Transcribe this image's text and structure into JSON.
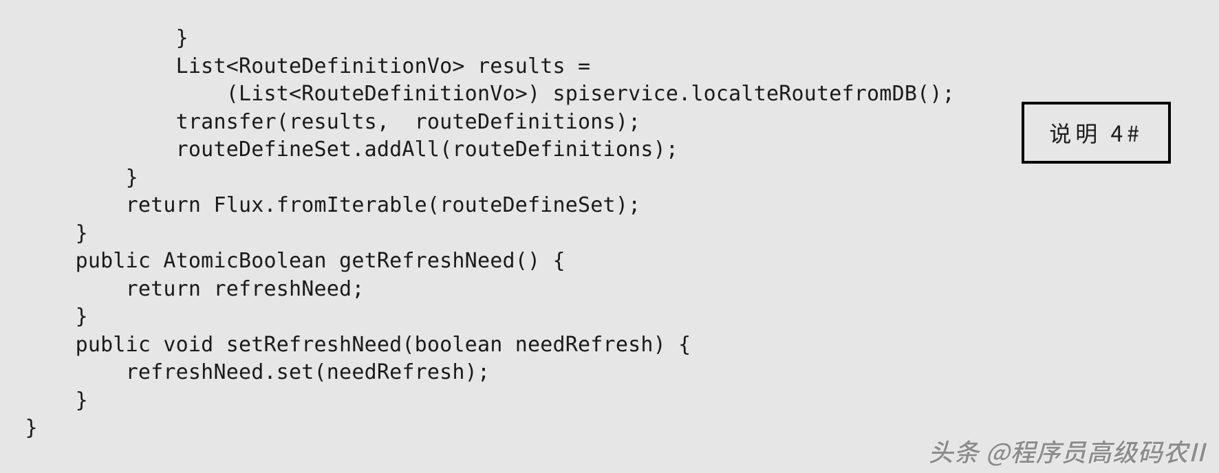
{
  "code": {
    "lines": [
      "              }",
      "              List<RouteDefinitionVo> results =",
      "                  (List<RouteDefinitionVo>) spiservice.localteRoutefromDB();",
      "              transfer(results,  routeDefinitions);",
      "              routeDefineSet.addAll(routeDefinitions);",
      "          }",
      "          return Flux.fromIterable(routeDefineSet);",
      "      }",
      "      public AtomicBoolean getRefreshNeed() {",
      "          return refreshNeed;",
      "      }",
      "      public void setRefreshNeed(boolean needRefresh) {",
      "          refreshNeed.set(needRefresh);",
      "      }",
      "  }"
    ]
  },
  "annotation": {
    "label": "说明 4#"
  },
  "watermark": {
    "text": "头条 @程序员高级码农II"
  }
}
